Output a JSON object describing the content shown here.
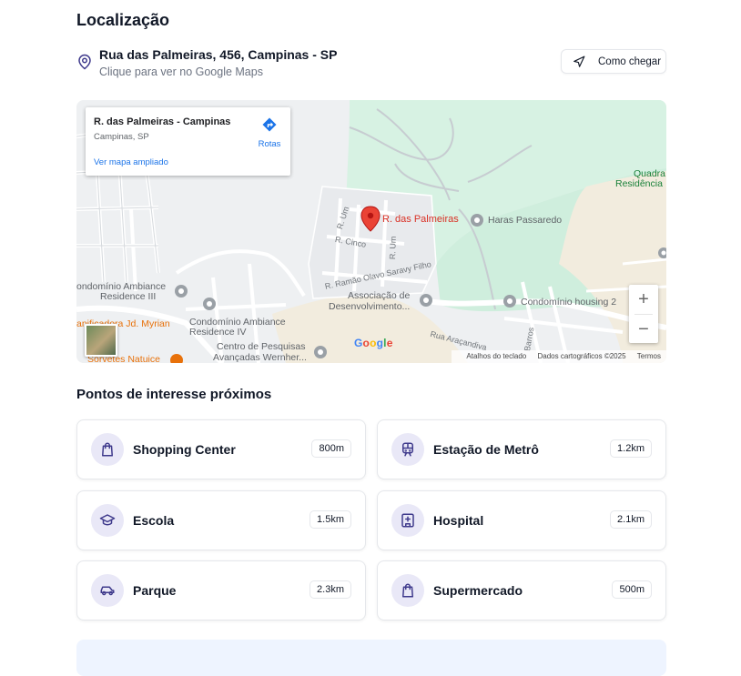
{
  "section": {
    "title": "Localização"
  },
  "address": {
    "line": "Rua das Palmeiras, 456, Campinas - SP",
    "hint": "Clique para ver no Google Maps",
    "directions_label": "Como chegar"
  },
  "map": {
    "info_card": {
      "place": "R. das Palmeiras - Campinas",
      "city": "Campinas, SP",
      "route_label": "Rotas",
      "bigger_map_link": "Ver mapa ampliado"
    },
    "marker_label": "R. das Palmeiras",
    "places": {
      "haras": "Haras Passaredo",
      "quadra": "Quadra",
      "residencia": "Residência",
      "cond3_a": "ondomínio Ambiance",
      "cond3_b": "Residence III",
      "cond4_a": "Condomínio Ambiance",
      "cond4_b": "Residence IV",
      "assoc_a": "Associação de",
      "assoc_b": "Desenvolvimento...",
      "housing": "Condomínio housing 2",
      "centro_a": "Centro de Pesquisas",
      "centro_b": "Avançadas Wernher...",
      "panif": "anificadora Jd. Myrian",
      "sorvetes": "Sorvetes Natuice"
    },
    "streets": {
      "um1": "R. Um",
      "um2": "R. Um",
      "cinco": "R. Cinco",
      "ramao": "R. Ramão Olavo Saravy Filho",
      "aracandiva": "Rua Araçandiva",
      "barros": "Barros"
    },
    "zoom_in": "+",
    "zoom_out": "−",
    "google": [
      "G",
      "o",
      "o",
      "g",
      "l",
      "e"
    ],
    "google_colors": [
      "#4285f4",
      "#ea4335",
      "#fbbc05",
      "#4285f4",
      "#34a853",
      "#ea4335"
    ],
    "attrib": {
      "keyboard": "Atalhos do teclado",
      "data": "Dados cartográficos ©2025",
      "terms": "Termos"
    }
  },
  "poi": {
    "title": "Pontos de interesse próximos",
    "items": [
      {
        "name": "Shopping Center",
        "distance": "800m",
        "icon": "shopping-bag-icon"
      },
      {
        "name": "Estação de Metrô",
        "distance": "1.2km",
        "icon": "train-icon"
      },
      {
        "name": "Escola",
        "distance": "1.5km",
        "icon": "graduation-cap-icon"
      },
      {
        "name": "Hospital",
        "distance": "2.1km",
        "icon": "hospital-icon"
      },
      {
        "name": "Parque",
        "distance": "2.3km",
        "icon": "car-icon"
      },
      {
        "name": "Supermercado",
        "distance": "500m",
        "icon": "shopping-bag-icon"
      }
    ]
  },
  "colors": {
    "accent": "#3f3a8c",
    "icon_bg": "#e9e8f7",
    "map_green": "#d7f2e3",
    "map_sand": "#f2ecde",
    "marker_red": "#ea4335"
  }
}
